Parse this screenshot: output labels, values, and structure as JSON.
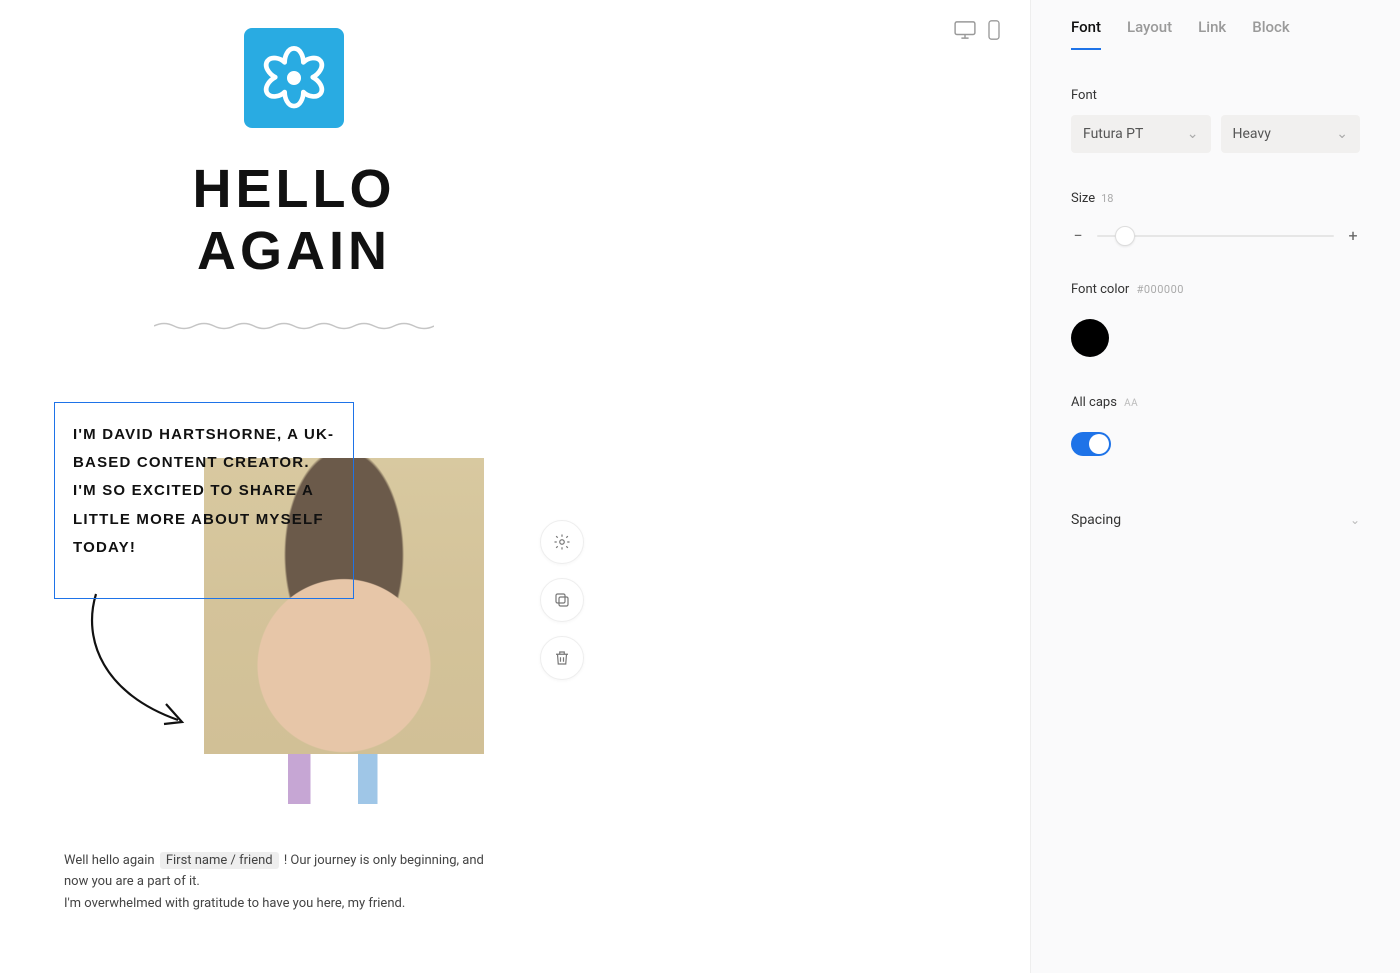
{
  "device_switch": {
    "desktop": "desktop-icon",
    "mobile": "mobile-icon"
  },
  "email": {
    "hello_line1": "HELLO",
    "hello_line2": "AGAIN",
    "intro_text": "I'm David Hartshorne, a UK-based content creator. I'm so excited to share a little more about myself today!",
    "body_p1_a": "Well hello again",
    "body_merge": "First name / friend",
    "body_p1_b": "! Our journey is only beginning, and now you are a part of it.",
    "body_p2": "I'm overwhelmed with gratitude to have you here, my friend."
  },
  "floating": {
    "settings": "settings",
    "duplicate": "duplicate",
    "delete": "delete"
  },
  "sidebar": {
    "tabs": {
      "font": "Font",
      "layout": "Layout",
      "link": "Link",
      "block": "Block"
    },
    "font": {
      "label": "Font",
      "family": "Futura PT",
      "weight": "Heavy"
    },
    "size": {
      "label": "Size",
      "value": "18",
      "thumb_pct": 12
    },
    "color": {
      "label": "Font color",
      "hex": "#000000"
    },
    "allcaps": {
      "label": "All caps",
      "hint": "AA",
      "on": true
    },
    "spacing": {
      "label": "Spacing"
    }
  }
}
